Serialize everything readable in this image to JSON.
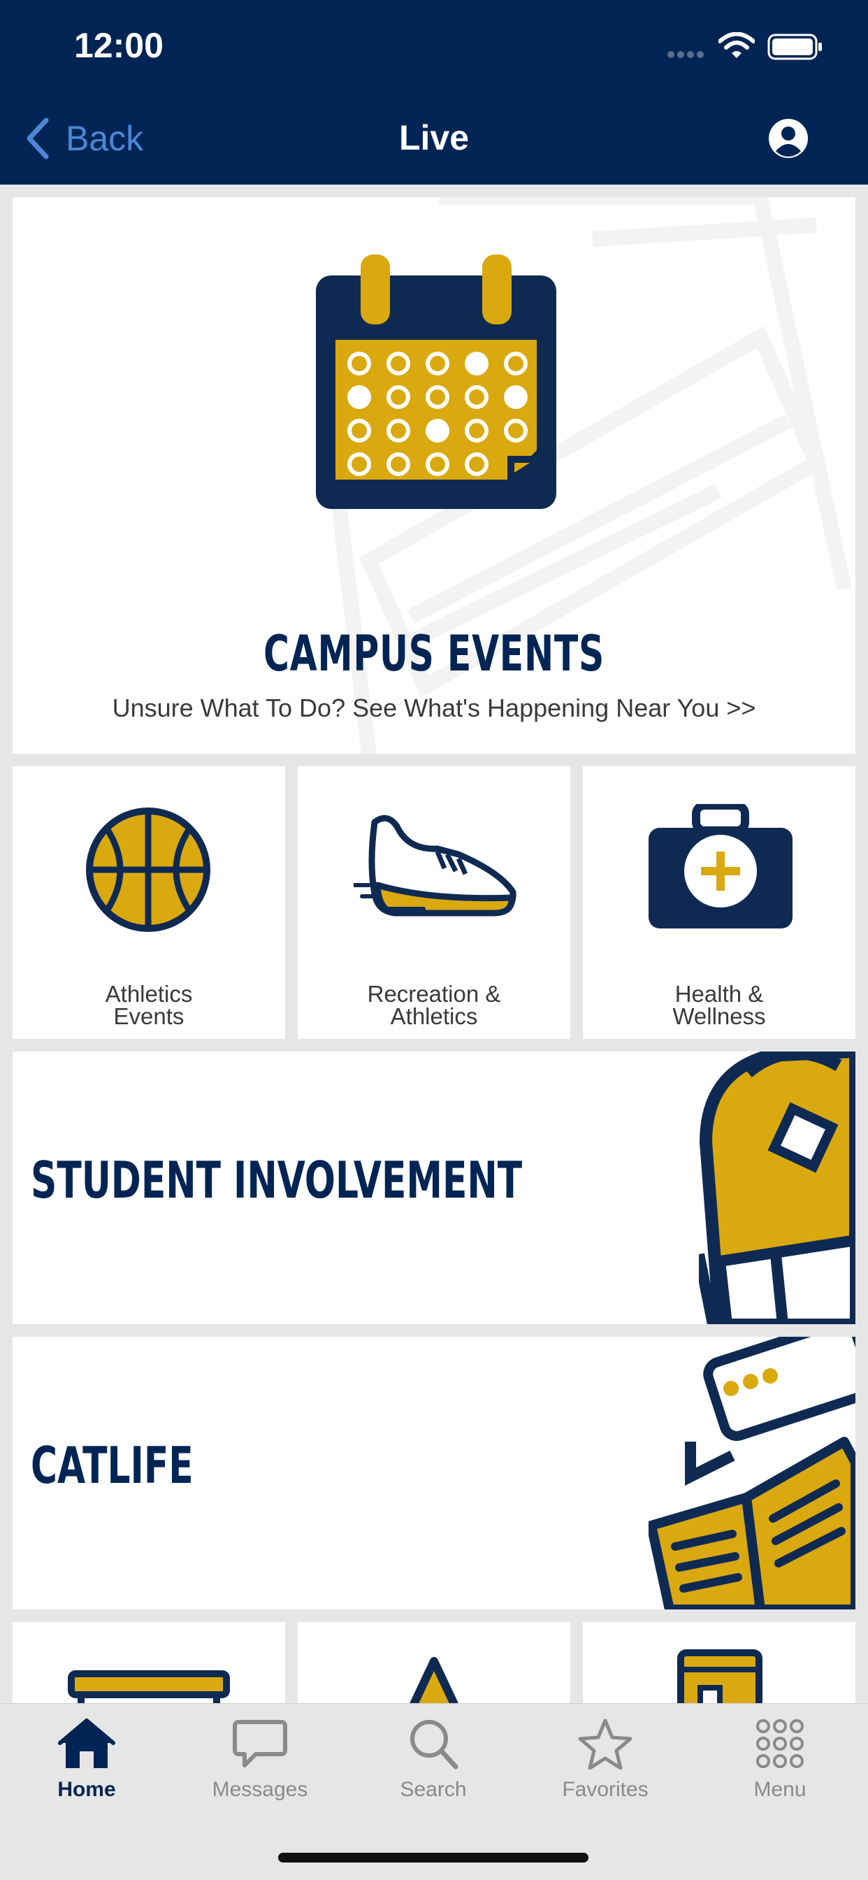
{
  "status_bar": {
    "time": "12:00"
  },
  "nav": {
    "back_label": "Back",
    "title": "Live"
  },
  "hero": {
    "title": "CAMPUS EVENTS",
    "subtitle": "Unsure What To Do? See What's Happening Near You >>"
  },
  "tiles": [
    {
      "label": "Athletics Events",
      "icon": "basketball-icon"
    },
    {
      "label": "Recreation & Athletics",
      "icon": "sneaker-icon"
    },
    {
      "label": "Health & Wellness",
      "icon": "first-aid-kit-icon"
    }
  ],
  "banners": [
    {
      "title": "STUDENT INVOLVEMENT",
      "icon": "backpack-icon"
    },
    {
      "title": "CATLIFE",
      "icon": "open-book-icon"
    }
  ],
  "tab_bar": {
    "items": [
      {
        "label": "Home",
        "icon": "home-icon",
        "active": true
      },
      {
        "label": "Messages",
        "icon": "chat-bubble-icon",
        "active": false
      },
      {
        "label": "Search",
        "icon": "search-icon",
        "active": false
      },
      {
        "label": "Favorites",
        "icon": "star-icon",
        "active": false
      },
      {
        "label": "Menu",
        "icon": "grid-menu-icon",
        "active": false
      }
    ]
  },
  "colors": {
    "navy": "#002554",
    "gold": "#d9a90f",
    "link_blue": "#4d86d6",
    "background": "#e6e6e6"
  }
}
